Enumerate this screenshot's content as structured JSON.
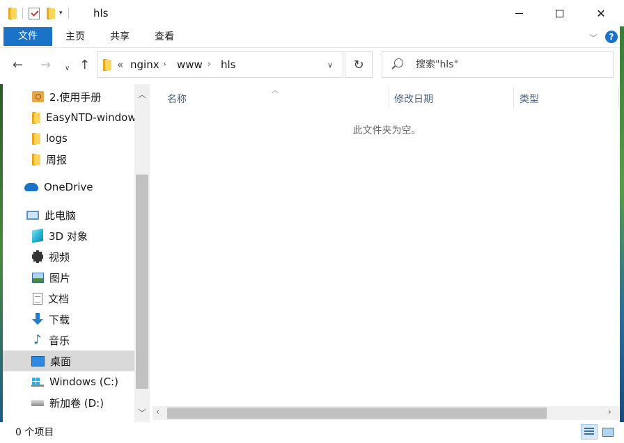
{
  "window": {
    "title": "hls",
    "minimize": "—",
    "maximize": "",
    "close": "✕"
  },
  "ribbon": {
    "tabs": [
      {
        "label": "文件"
      },
      {
        "label": "主页"
      },
      {
        "label": "共享"
      },
      {
        "label": "查看"
      }
    ],
    "accent_color": "#1a73c6"
  },
  "nav": {
    "breadcrumb_prefix": "«",
    "breadcrumb": [
      "nginx",
      "www",
      "hls"
    ],
    "search_placeholder": "搜索\"hls\""
  },
  "sidebar": {
    "items": [
      {
        "label": "2.使用手册",
        "icon": "zip-folder-icon"
      },
      {
        "label": "EasyNTD-windows",
        "icon": "folder-icon"
      },
      {
        "label": "logs",
        "icon": "folder-icon"
      },
      {
        "label": "周报",
        "icon": "folder-icon"
      },
      {
        "label": "OneDrive",
        "icon": "onedrive-icon"
      },
      {
        "label": "此电脑",
        "icon": "computer-icon"
      },
      {
        "label": "3D 对象",
        "icon": "3d-objects-icon"
      },
      {
        "label": "视频",
        "icon": "video-icon"
      },
      {
        "label": "图片",
        "icon": "pictures-icon"
      },
      {
        "label": "文档",
        "icon": "documents-icon"
      },
      {
        "label": "下载",
        "icon": "downloads-icon"
      },
      {
        "label": "音乐",
        "icon": "music-icon"
      },
      {
        "label": "桌面",
        "icon": "desktop-icon",
        "selected": true
      },
      {
        "label": "Windows (C:)",
        "icon": "windows-drive-icon"
      },
      {
        "label": "新加卷 (D:)",
        "icon": "drive-icon"
      }
    ]
  },
  "main": {
    "columns": [
      {
        "label": "名称"
      },
      {
        "label": "修改日期"
      },
      {
        "label": "类型"
      }
    ],
    "empty_message": "此文件夹为空。"
  },
  "status": {
    "item_count": "0 个项目"
  }
}
